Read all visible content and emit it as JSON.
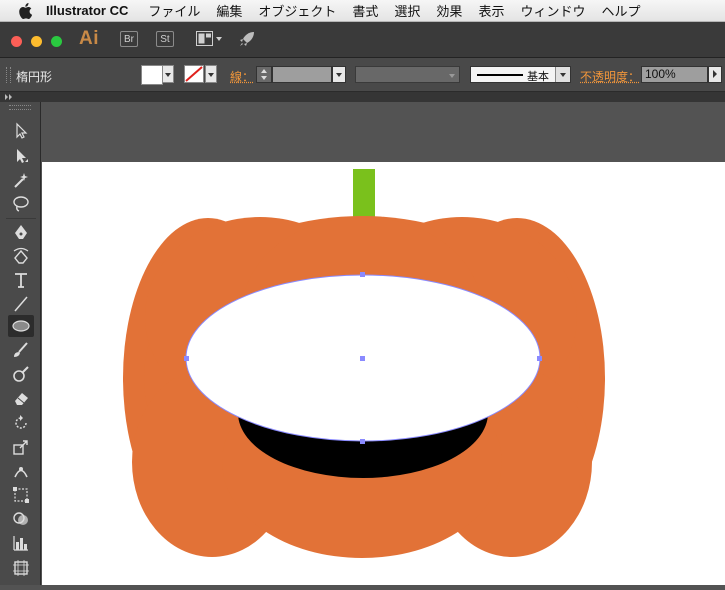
{
  "menubar": {
    "apple_icon": "apple-icon",
    "app_name": "Illustrator CC",
    "items": [
      "ファイル",
      "編集",
      "オブジェクト",
      "書式",
      "選択",
      "効果",
      "表示",
      "ウィンドウ",
      "ヘルプ"
    ]
  },
  "appbar": {
    "logo": "Ai",
    "bridge_label": "Br",
    "stock_label": "St",
    "traffic_lights": [
      "#fc5f57",
      "#fdbc2e",
      "#2ac940"
    ],
    "logo_color": "#c98a47"
  },
  "control_panel": {
    "object_type": "楕円形",
    "fill_color": "#ffffff",
    "stroke_label": "線：",
    "stroke_preset_label": "基本",
    "opacity_label": "不透明度：",
    "opacity_value": "100%"
  },
  "toolbar": {
    "tools": [
      "selection-tool",
      "direct-selection-tool",
      "magic-wand-tool",
      "lasso-tool",
      "pen-tool",
      "curvature-tool",
      "type-tool",
      "line-tool",
      "ellipse-tool",
      "paintbrush-tool",
      "shaper-tool",
      "eraser-tool",
      "rotate-tool",
      "scale-tool",
      "puppet-warp-tool",
      "free-transform-tool",
      "shape-builder-tool",
      "graph-tool",
      "artboard-tool"
    ],
    "selected_tool": "ellipse-tool"
  },
  "artwork": {
    "pumpkin_color": "#e27237",
    "stem_color": "#7ac11c",
    "mouth_color": "#000000",
    "selected_ellipse_fill": "#ffffff",
    "selection_color": "#8a8aff"
  }
}
